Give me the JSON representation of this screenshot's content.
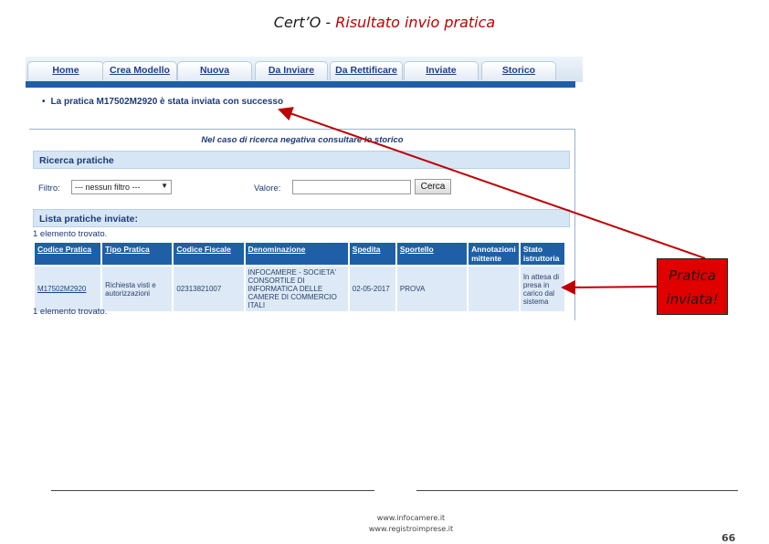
{
  "slide": {
    "title_part1": "Cert’O  - ",
    "title_part2": "Risultato invio pratica",
    "callout": "Pratica inviata!",
    "footer_line1": "www.infocamere.it",
    "footer_line2": "www.registroimprese.it",
    "page_number": "66"
  },
  "nav": {
    "tabs": [
      "Home",
      "Crea Modello",
      "Nuova",
      "Da Inviare",
      "Da Rettificare",
      "Inviate",
      "Storico"
    ]
  },
  "message": {
    "bullet": "•",
    "text": "La pratica M17502M2920 è stata inviata con successo"
  },
  "search": {
    "hint": "Nel caso di ricerca negativa consultare lo storico",
    "section_title": "Ricerca pratiche",
    "filter_label": "Filtro:",
    "filter_value": "--- nessun filtro ---",
    "value_label": "Valore:",
    "value_input": "",
    "search_button": "Cerca"
  },
  "list": {
    "section_title": "Lista pratiche inviate:",
    "count_top": "1 elemento trovato.",
    "count_bottom": "1 elemento trovato.",
    "headers": [
      "Codice Pratica",
      "Tipo Pratica",
      "Codice Fiscale",
      "Denominazione",
      "Spedita",
      "Sportello",
      "Annotazioni mittente",
      "Stato istruttoria"
    ],
    "rows": [
      {
        "codice_pratica": "M17502M2920",
        "tipo_pratica": "Richiesta visti e autorizzazioni",
        "codice_fiscale": "02313821007",
        "denominazione": "INFOCAMERE - SOCIETA' CONSORTILE DI INFORMATICA DELLE CAMERE DI COMMERCIO ITALI",
        "spedita": "02-05-2017",
        "sportello": "PROVA",
        "annotazioni": "",
        "stato": "In attesa di presa in carico dal sistema"
      }
    ]
  },
  "colors": {
    "accent_blue": "#1e5fa8",
    "callout_red": "#e00000",
    "title_red": "#c00000"
  }
}
